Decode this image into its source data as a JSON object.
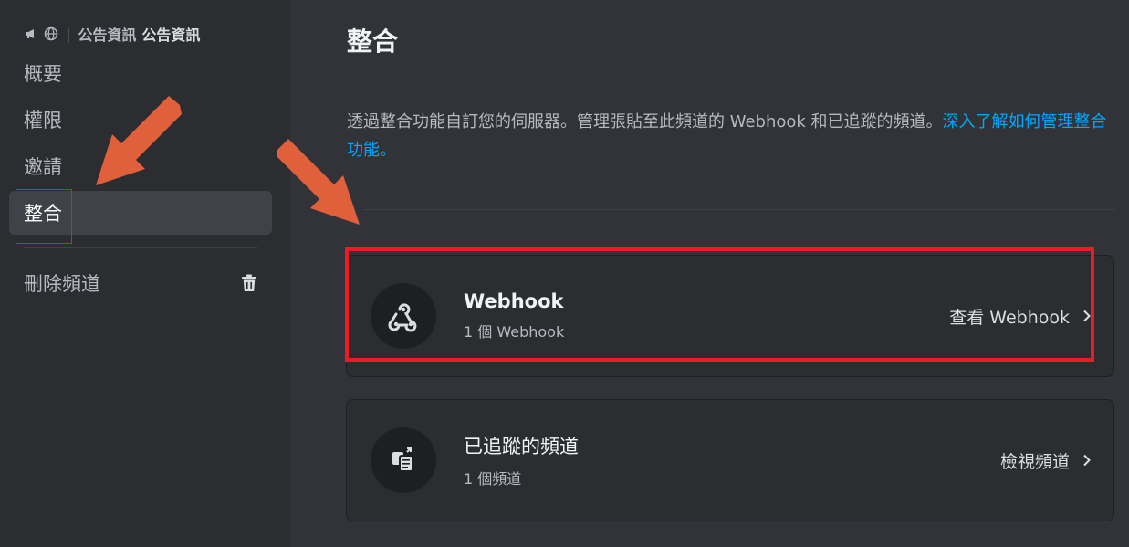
{
  "sidebar": {
    "breadcrumb_light": "公告資訊",
    "breadcrumb_bold": "公告資訊",
    "items": [
      {
        "label": "概要"
      },
      {
        "label": "權限"
      },
      {
        "label": "邀請"
      },
      {
        "label": "整合"
      }
    ],
    "delete_label": "刪除頻道"
  },
  "main": {
    "title": "整合",
    "description": "透過整合功能自訂您的伺服器。管理張貼至此頻道的 Webhook 和已追蹤的頻道。",
    "learn_more": "深入了解如何管理整合功能。",
    "cards": [
      {
        "title": "Webhook",
        "subtitle": "1 個 Webhook",
        "action": "查看 Webhook",
        "icon": "webhook-icon"
      },
      {
        "title": "已追蹤的頻道",
        "subtitle": "1 個頻道",
        "action": "檢視頻道",
        "icon": "followed-channel-icon"
      }
    ]
  },
  "colors": {
    "annotation_arrow": "#e0603c",
    "annotation_box": "#ed1c24",
    "link": "#00a8fc"
  }
}
